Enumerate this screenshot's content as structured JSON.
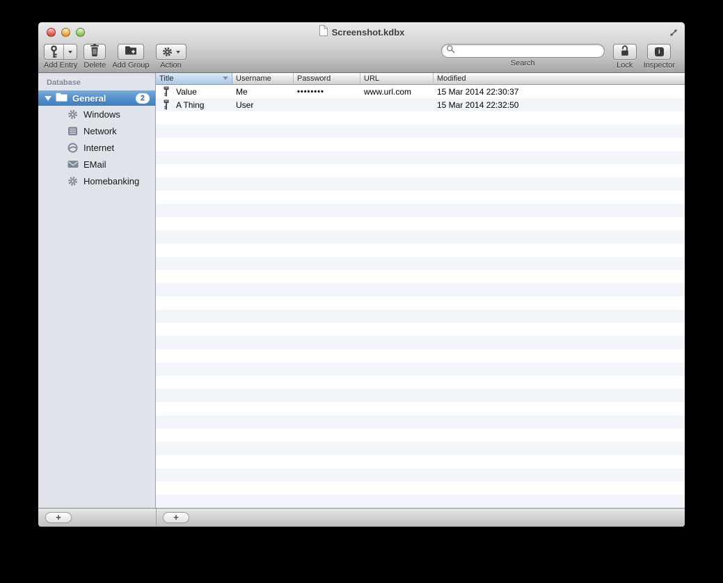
{
  "window": {
    "title": "Screenshot.kdbx",
    "controls": [
      "close",
      "minimize",
      "zoom"
    ],
    "fullscreen_icon": "expand-arrows-icon"
  },
  "toolbar": {
    "add_entry": {
      "label": "Add Entry",
      "icon": "key-icon",
      "has_dropdown": true
    },
    "delete": {
      "label": "Delete",
      "icon": "trash-icon"
    },
    "add_group": {
      "label": "Add Group",
      "icon": "folder-plus-icon"
    },
    "action": {
      "label": "Action",
      "icon": "gear-icon",
      "has_dropdown": true
    },
    "search": {
      "label": "Search",
      "value": "",
      "placeholder": "",
      "icon": "magnifier-icon"
    },
    "lock": {
      "label": "Lock",
      "icon": "open-padlock-icon"
    },
    "inspector": {
      "label": "Inspector",
      "icon": "info-icon",
      "glyph": "i"
    }
  },
  "sidebar": {
    "section_header": "Database",
    "root_group": {
      "label": "General",
      "badge": "2",
      "icon": "folder-icon",
      "expanded": true,
      "selected": true
    },
    "items": [
      {
        "label": "Windows",
        "icon": "gear-icon"
      },
      {
        "label": "Network",
        "icon": "server-icon"
      },
      {
        "label": "Internet",
        "icon": "globe-icon"
      },
      {
        "label": "EMail",
        "icon": "envelope-icon"
      },
      {
        "label": "Homebanking",
        "icon": "gear-icon"
      }
    ]
  },
  "table": {
    "columns": [
      "Title",
      "Username",
      "Password",
      "URL",
      "Modified"
    ],
    "sorted_by": "Title",
    "sort_direction": "descending",
    "rows": [
      {
        "icon": "key-icon",
        "title": "Value",
        "username": "Me",
        "password": "••••••••",
        "url": "www.url.com",
        "modified": "15 Mar 2014 22:30:37"
      },
      {
        "icon": "key-icon",
        "title": "A Thing",
        "username": "User",
        "password": "",
        "url": "",
        "modified": "15 Mar 2014 22:32:50"
      }
    ]
  },
  "bottom_bar": {
    "add_group_button": "+",
    "add_entry_button": "+"
  },
  "colors": {
    "selection_blue_top": "#79acde",
    "selection_blue_bottom": "#3f7fc1",
    "sorted_header_blue": "#c4daf0",
    "row_stripe": "#f2f6fa",
    "sidebar_background": "#e0e3e9",
    "sidebar_icon_gray": "#7d8896",
    "chrome_gradient_top": "#eaeaea",
    "chrome_gradient_bottom": "#a4a4a4"
  }
}
